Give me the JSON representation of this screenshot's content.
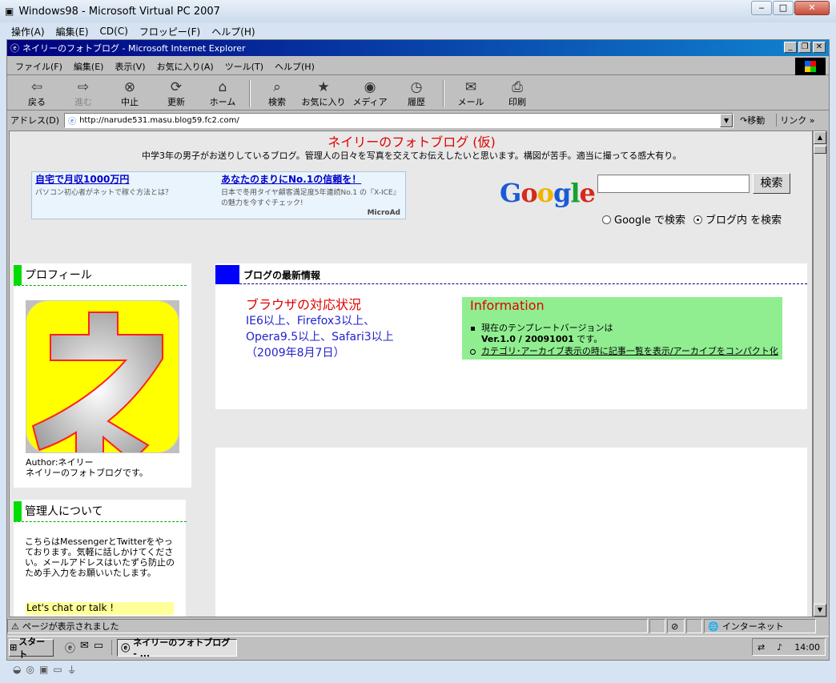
{
  "vpc": {
    "title": "Windows98 - Microsoft Virtual PC 2007",
    "menu": [
      "操作(A)",
      "編集(E)",
      "CD(C)",
      "フロッピー(F)",
      "ヘルプ(H)"
    ]
  },
  "ie": {
    "title": "ネイリーのフォトブログ - Microsoft Internet Explorer",
    "menu": [
      "ファイル(F)",
      "編集(E)",
      "表示(V)",
      "お気に入り(A)",
      "ツール(T)",
      "ヘルプ(H)"
    ],
    "toolbar": {
      "back": "戻る",
      "forward": "進む",
      "stop": "中止",
      "refresh": "更新",
      "home": "ホーム",
      "search": "検索",
      "favorites": "お気に入り",
      "media": "メディア",
      "history": "履歴",
      "mail": "メール",
      "print": "印刷"
    },
    "address_label": "アドレス(D)",
    "address_url": "http://narude531.masu.blog59.fc2.com/",
    "go_label": "移動",
    "links_label": "リンク",
    "status_text": "ページが表示されました",
    "zone_text": "インターネット"
  },
  "page": {
    "blog_title": "ネイリーのフォトブログ (仮)",
    "blog_description": "中学3年の男子がお送りしているブログ。管理人の日々を写真を交えてお伝えしたいと思います。構図が苦手。適当に撮ってる感大有り。",
    "ad": {
      "item1_title": "自宅で月収1000万円",
      "item1_text": "パソコン初心者がネットで稼ぐ方法とは？",
      "item2_title": "あなたのまりにNo.1の信頼を！",
      "item2_text": "日本で冬用タイヤ顧客満足度5年連続No.1 の『X-ICE』の魅力を今すぐチェック!",
      "brand": "MicroAd"
    },
    "google": {
      "logo": "Google",
      "search_button": "検索",
      "option_web": "Google で検索",
      "option_blog": "ブログ内 を検索"
    },
    "profile": {
      "heading": "プロフィール",
      "avatar_char": "ネ",
      "author": "Author:ネイリー",
      "description": "ネイリーのフォトブログです。"
    },
    "about": {
      "heading": "管理人について",
      "text": "こちらはMessengerとTwitterをやっております。気軽に話しかけてください。メールアドレスはいたずら防止のため手入力をお願いいたします。",
      "chat_label": "Let's chat or talk !"
    },
    "news": {
      "heading": "ブログの最新情報",
      "browser_heading": "ブラウザの対応状況",
      "browser_line1": "IE6以上、Firefox3以上、",
      "browser_line2": "Opera9.5以上、Safari3以上",
      "browser_line3": "（2009年8月7日）",
      "info_heading": "Information",
      "info_item1": "現在のテンプレートバージョンは",
      "info_version": "Ver.1.0 / 20091001",
      "info_version_suffix": " です。",
      "info_item2": "カテゴリ･アーカイブ表示の時に記事一覧を表示/アーカイブをコンパクト化"
    }
  },
  "taskbar": {
    "start": "スタート",
    "task_label": "ネイリーのフォトブログ - ...",
    "clock": "14:00"
  },
  "colors": {
    "blog_title": "#e00000",
    "profile_accent": "#00dd00",
    "news_accent": "#0000ff",
    "info_bg": "#90ee90",
    "ie_title": "#000080"
  }
}
